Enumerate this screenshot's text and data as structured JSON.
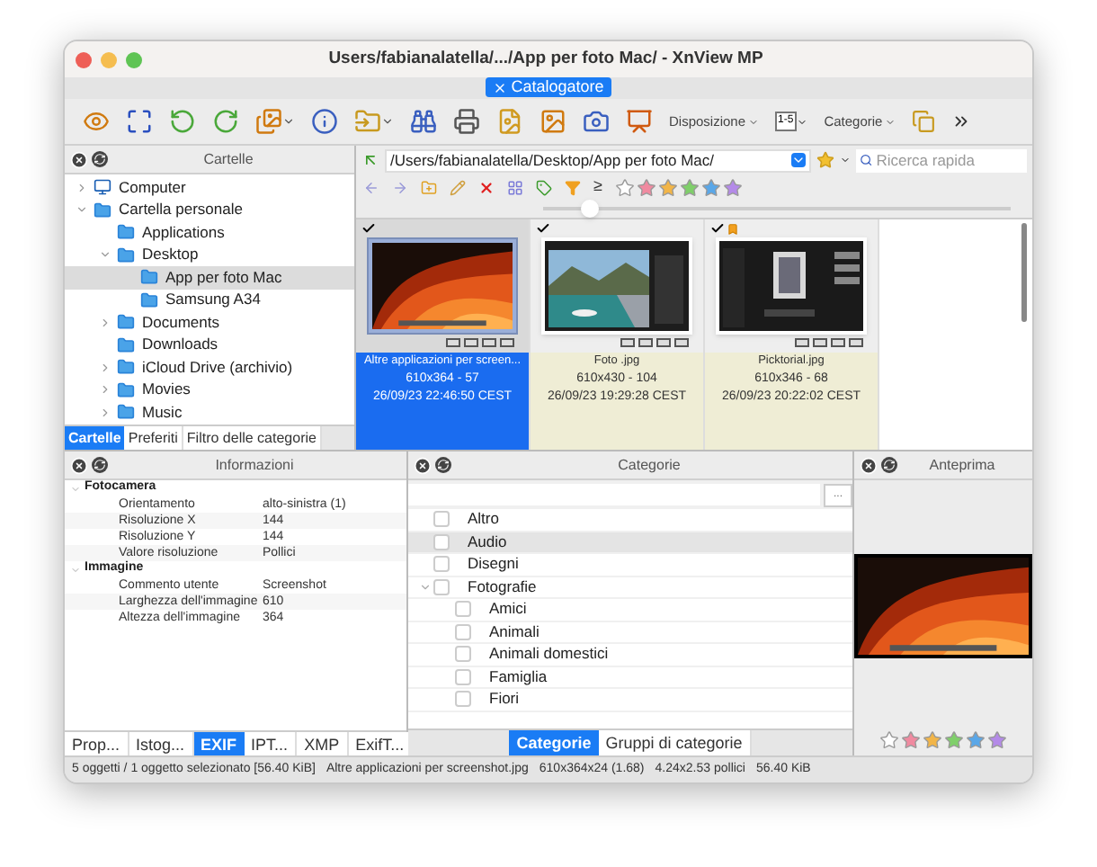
{
  "window": {
    "title": "Users/fabianalatella/.../App per foto Mac/ - XnView MP"
  },
  "doc_tab": {
    "label": "Catalogatore"
  },
  "toolbar": {
    "menus": [
      {
        "label": "Disposizione"
      },
      {
        "label": "Categorie"
      }
    ],
    "rating_label": "1-5"
  },
  "folders": {
    "title": "Cartelle",
    "tree": [
      {
        "label": "Computer",
        "kind": "computer",
        "expandable": true,
        "expanded": false,
        "selected": false
      },
      {
        "label": "Cartella personale",
        "kind": "folder",
        "expandable": true,
        "expanded": true,
        "selected": false,
        "children": [
          {
            "label": "Applications",
            "kind": "folder",
            "expandable": false,
            "selected": false
          },
          {
            "label": "Desktop",
            "kind": "folder",
            "expandable": true,
            "expanded": true,
            "selected": false,
            "children": [
              {
                "label": "App per foto Mac",
                "kind": "folder",
                "expandable": false,
                "selected": true
              },
              {
                "label": "Samsung A34",
                "kind": "folder",
                "expandable": false,
                "selected": false
              }
            ]
          },
          {
            "label": "Documents",
            "kind": "folder",
            "expandable": true,
            "expanded": false,
            "selected": false
          },
          {
            "label": "Downloads",
            "kind": "folder",
            "expandable": false,
            "selected": false
          },
          {
            "label": "iCloud Drive (archivio)",
            "kind": "folder",
            "expandable": true,
            "expanded": false,
            "selected": false
          },
          {
            "label": "Movies",
            "kind": "folder",
            "expandable": true,
            "expanded": false,
            "selected": false
          },
          {
            "label": "Music",
            "kind": "folder",
            "expandable": true,
            "expanded": false,
            "selected": false
          }
        ]
      }
    ],
    "tabs": [
      {
        "label": "Cartelle",
        "selected": true
      },
      {
        "label": "Preferiti",
        "selected": false
      },
      {
        "label": "Filtro delle categorie",
        "selected": false
      }
    ]
  },
  "browser": {
    "path": "/Users/fabianalatella/Desktop/App per foto Mac/",
    "search": {
      "placeholder": "Ricerca rapida"
    },
    "ge_symbol": "≥",
    "zoom": {
      "level": 0.1
    },
    "thumbnails": [
      {
        "kind": "wallpaper",
        "name": "Altre applicazioni per screen...",
        "size": "610x364 - 57",
        "date": "26/09/23 22:46:50 CEST",
        "selected": true,
        "checked": true,
        "flagged": false
      },
      {
        "kind": "lake",
        "name": "Foto .jpg",
        "size": "610x430 - 104",
        "date": "26/09/23 19:29:28 CEST",
        "selected": false,
        "checked": true,
        "flagged": false
      },
      {
        "kind": "app",
        "name": "Picktorial.jpg",
        "size": "610x346 - 68",
        "date": "26/09/23 20:22:02 CEST",
        "selected": false,
        "checked": true,
        "flagged": true
      }
    ]
  },
  "info": {
    "title": "Informazioni",
    "groups": [
      {
        "name": "Fotocamera",
        "expanded": true,
        "rows": [
          {
            "label": "Orientamento",
            "value": "alto-sinistra (1)"
          },
          {
            "label": "Risoluzione X",
            "value": "144"
          },
          {
            "label": "Risoluzione Y",
            "value": "144"
          },
          {
            "label": "Valore risoluzione",
            "value": "Pollici"
          }
        ]
      },
      {
        "name": "Immagine",
        "expanded": true,
        "rows": [
          {
            "label": "Commento utente",
            "value": "Screenshot"
          },
          {
            "label": "Larghezza dell'immagine",
            "value": "610"
          },
          {
            "label": "Altezza dell'immagine",
            "value": "364"
          }
        ]
      }
    ],
    "tabs": [
      {
        "label": "Prop...",
        "selected": false
      },
      {
        "label": "Istog...",
        "selected": false
      },
      {
        "label": "EXIF",
        "selected": true
      },
      {
        "label": "IPT...",
        "selected": false
      },
      {
        "label": "XMP",
        "selected": false
      },
      {
        "label": "ExifT...",
        "selected": false
      }
    ]
  },
  "categories": {
    "title": "Categorie",
    "more_button": "...",
    "items": [
      {
        "label": "Altro",
        "checked": false,
        "selected": false
      },
      {
        "label": "Audio",
        "checked": false,
        "selected": true
      },
      {
        "label": "Disegni",
        "checked": false,
        "selected": false
      },
      {
        "label": "Fotografie",
        "checked": false,
        "selected": false,
        "expanded": true,
        "children": [
          {
            "label": "Amici",
            "checked": false,
            "selected": false
          },
          {
            "label": "Animali",
            "checked": false,
            "selected": false
          },
          {
            "label": "Animali domestici",
            "checked": false,
            "selected": false
          },
          {
            "label": "Famiglia",
            "checked": false,
            "selected": false
          },
          {
            "label": "Fiori",
            "checked": false,
            "selected": false
          }
        ]
      }
    ],
    "tabs": [
      {
        "label": "Categorie",
        "selected": true
      },
      {
        "label": "Gruppi di categorie",
        "selected": false
      }
    ]
  },
  "preview": {
    "title": "Anteprima"
  },
  "status_bar": [
    "5 oggetti / 1 oggetto selezionato [56.40 KiB]",
    "Altre applicazioni per screenshot.jpg",
    "610x364x24 (1.68)",
    "4.24x2.53 pollici",
    "56.40 KiB"
  ]
}
